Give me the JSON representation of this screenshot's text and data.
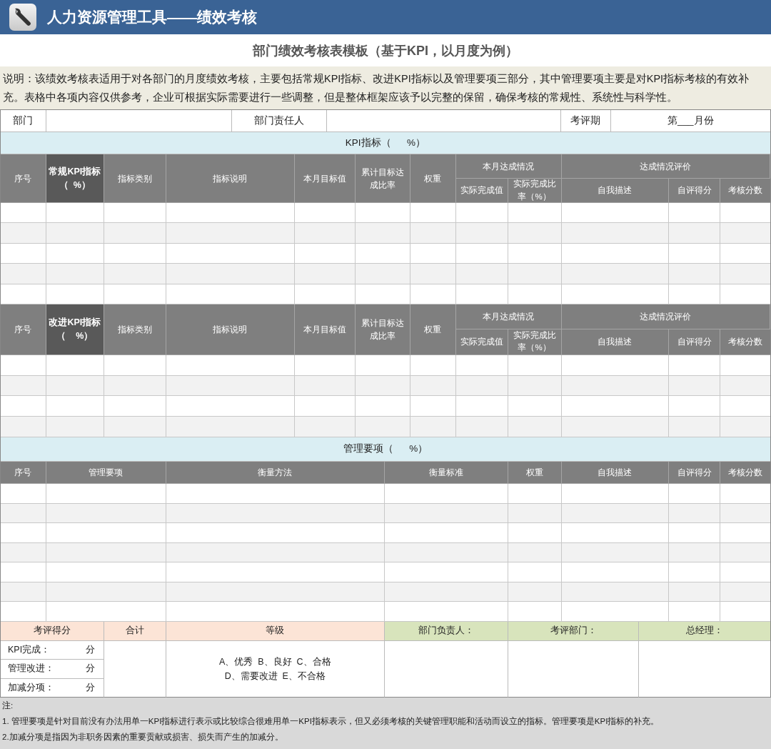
{
  "header": {
    "title": "人力资源管理工具——绩效考核"
  },
  "form_title": "部门绩效考核表模板（基于KPI，以月度为例）",
  "description": "说明：该绩效考核表适用于对各部门的月度绩效考核，主要包括常规KPI指标、改进KPI指标以及管理要项三部分，其中管理要项主要是对KPI指标考核的有效补充。表格中各项内容仅供参考，企业可根据实际需要进行一些调整，但是整体框架应该予以完整的保留，确保考核的常规性、系统性与科学性。",
  "info_fields": [
    {
      "label": "部门"
    },
    {
      "label": "部门责任人"
    },
    {
      "label": "考评期",
      "value": "第___月份"
    }
  ],
  "kpi_section": {
    "title": "KPI指标（      %）"
  },
  "regular_kpi_table": {
    "columns": [
      {
        "kind": "single",
        "label": "序号",
        "highlight": false
      },
      {
        "kind": "single",
        "label": "常规KPI指标（  %）",
        "highlight": true
      },
      {
        "kind": "single",
        "label": "指标类别",
        "highlight": false
      },
      {
        "kind": "single",
        "label": "指标说明",
        "highlight": false
      },
      {
        "kind": "single",
        "label": "本月目标值",
        "highlight": false
      },
      {
        "kind": "single",
        "label": "累计目标达成比率",
        "highlight": false
      },
      {
        "kind": "single",
        "label": "权重",
        "highlight": false
      },
      {
        "kind": "group",
        "label": "本月达成情况",
        "children": [
          "实际完成值",
          "实际完成比率（%）"
        ]
      },
      {
        "kind": "group",
        "label": "达成情况评价",
        "children": [
          "自我描述",
          "自评得分",
          "考核分数"
        ]
      }
    ]
  },
  "improvement_kpi_table": {
    "columns": [
      {
        "kind": "single",
        "label": "序号",
        "highlight": false
      },
      {
        "kind": "single",
        "label": "改进KPI指标（    %）",
        "highlight": true
      },
      {
        "kind": "single",
        "label": "指标类别",
        "highlight": false
      },
      {
        "kind": "single",
        "label": "指标说明",
        "highlight": false
      },
      {
        "kind": "single",
        "label": "本月目标值",
        "highlight": false
      },
      {
        "kind": "single",
        "label": "累计目标达成比率",
        "highlight": false
      },
      {
        "kind": "single",
        "label": "权重",
        "highlight": false
      },
      {
        "kind": "group",
        "label": "本月达成情况",
        "children": [
          "实际完成值",
          "实际完成比率（%）"
        ]
      },
      {
        "kind": "group",
        "label": "达成情况评价",
        "children": [
          "自我描述",
          "自评得分",
          "考核分数"
        ]
      }
    ]
  },
  "management_section": {
    "title": "管理要项（      %）",
    "columns": [
      "序号",
      "管理要项",
      "衡量方法",
      "衡量标准",
      "权重",
      "自我描述",
      "自评得分",
      "考核分数"
    ]
  },
  "summary": {
    "headers": [
      {
        "label": "考评得分",
        "color": "#fce4d6"
      },
      {
        "label": "合计",
        "color": "#fce4d6"
      },
      {
        "label": "等级",
        "color": "#fce4d6"
      },
      {
        "label": "部门负责人：",
        "color": "#d8e4bc"
      },
      {
        "label": "考评部门：",
        "color": "#d8e4bc"
      },
      {
        "label": "总经理：",
        "color": "#d8e4bc"
      }
    ],
    "score_items": [
      {
        "label": "KPI完成：",
        "unit": "分"
      },
      {
        "label": "管理改进：",
        "unit": "分"
      },
      {
        "label": "加减分项：",
        "unit": "分"
      }
    ],
    "grades": [
      "A、优秀  B、良好  C、合格",
      "D、需要改进  E、不合格"
    ]
  },
  "notes": {
    "heading": "注:",
    "items": [
      "1. 管理要项是针对目前没有办法用单一KPI指标进行表示或比较综合很难用单一KPI指标表示，但又必须考核的关键管理职能和活动而设立的指标。管理要项是KPI指标的补充。",
      "2.加减分项是指因为非职务因素的重要贡献或损害、损失而产生的加减分。"
    ]
  }
}
